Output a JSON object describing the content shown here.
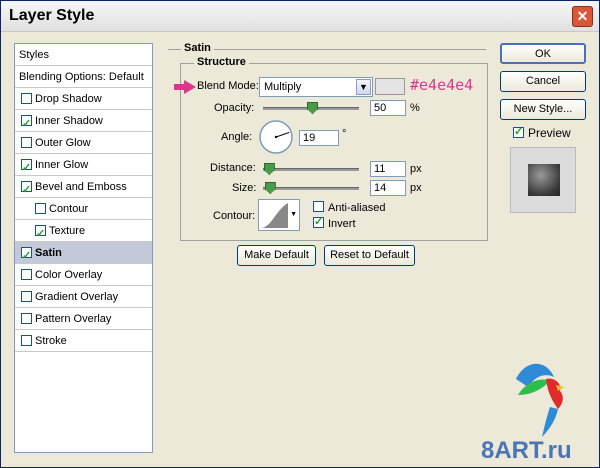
{
  "window": {
    "title": "Layer Style"
  },
  "sidebar": {
    "items": [
      {
        "label": "Styles",
        "has_checkbox": false,
        "checked": false,
        "selected": false
      },
      {
        "label": "Blending Options: Default",
        "has_checkbox": false,
        "checked": false,
        "selected": false
      },
      {
        "label": "Drop Shadow",
        "has_checkbox": true,
        "checked": false,
        "selected": false
      },
      {
        "label": "Inner Shadow",
        "has_checkbox": true,
        "checked": true,
        "selected": false
      },
      {
        "label": "Outer Glow",
        "has_checkbox": true,
        "checked": false,
        "selected": false
      },
      {
        "label": "Inner Glow",
        "has_checkbox": true,
        "checked": true,
        "selected": false
      },
      {
        "label": "Bevel and Emboss",
        "has_checkbox": true,
        "checked": true,
        "selected": false
      },
      {
        "label": "Contour",
        "has_checkbox": true,
        "checked": false,
        "selected": false,
        "sub": true
      },
      {
        "label": "Texture",
        "has_checkbox": true,
        "checked": true,
        "selected": false,
        "sub": true
      },
      {
        "label": "Satin",
        "has_checkbox": true,
        "checked": true,
        "selected": true
      },
      {
        "label": "Color Overlay",
        "has_checkbox": true,
        "checked": false,
        "selected": false
      },
      {
        "label": "Gradient Overlay",
        "has_checkbox": true,
        "checked": false,
        "selected": false
      },
      {
        "label": "Pattern Overlay",
        "has_checkbox": true,
        "checked": false,
        "selected": false
      },
      {
        "label": "Stroke",
        "has_checkbox": true,
        "checked": false,
        "selected": false
      }
    ]
  },
  "satin": {
    "group_title": "Satin",
    "structure_title": "Structure",
    "blend_mode_label": "Blend Mode:",
    "blend_mode_value": "Multiply",
    "color_annotation": "#e4e4e4",
    "swatch_color": "#e4e4e4",
    "opacity_label": "Opacity:",
    "opacity_value": "50",
    "opacity_unit": "%",
    "opacity_fraction": 0.5,
    "angle_label": "Angle:",
    "angle_value": "19",
    "angle_unit": "°",
    "distance_label": "Distance:",
    "distance_value": "11",
    "distance_unit": "px",
    "distance_fraction": 0.05,
    "size_label": "Size:",
    "size_value": "14",
    "size_unit": "px",
    "size_fraction": 0.06,
    "contour_label": "Contour:",
    "anti_aliased_label": "Anti-aliased",
    "anti_aliased_checked": false,
    "invert_label": "Invert",
    "invert_checked": true
  },
  "buttons": {
    "make_default": "Make Default",
    "reset_default": "Reset to Default",
    "ok": "OK",
    "cancel": "Cancel",
    "new_style": "New Style...",
    "preview_label": "Preview",
    "preview_checked": true
  },
  "watermark": {
    "text": "8ART.ru"
  },
  "colors": {
    "accent": "#e0358c",
    "selected_row": "#c3c9d9"
  }
}
